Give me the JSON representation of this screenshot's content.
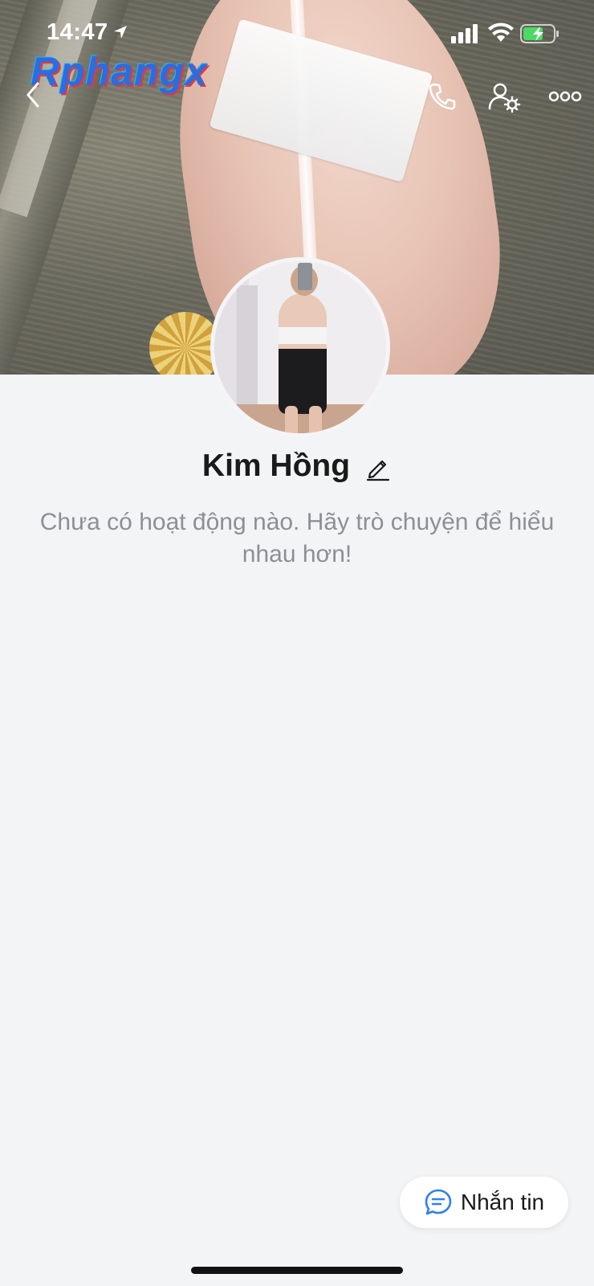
{
  "status_bar": {
    "time": "14:47"
  },
  "watermark": "Rphangx",
  "header": {
    "back_icon": "chevron-left-icon",
    "call_icon": "phone-icon",
    "settings_icon": "user-settings-icon",
    "more_icon": "more-horizontal-icon"
  },
  "profile": {
    "name": "Kim Hồng",
    "empty_message": "Chưa có hoạt động nào. Hãy trò chuyện để hiểu nhau hơn!"
  },
  "actions": {
    "message_label": "Nhắn tin",
    "message_icon": "chat-bubble-icon"
  },
  "colors": {
    "accent": "#2f7ff6",
    "background": "#f3f4f6",
    "battery_fill": "#4cd964"
  }
}
